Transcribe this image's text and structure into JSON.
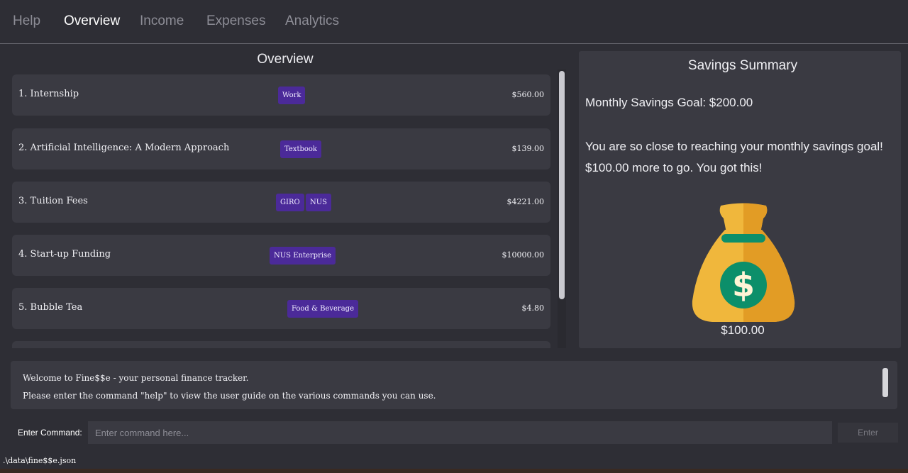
{
  "tabs": [
    {
      "label": "Help",
      "active": false
    },
    {
      "label": "Overview",
      "active": true
    },
    {
      "label": "Income",
      "active": false
    },
    {
      "label": "Expenses",
      "active": false
    },
    {
      "label": "Analytics",
      "active": false
    }
  ],
  "overview": {
    "title": "Overview",
    "items": [
      {
        "name": "1. Internship",
        "tags": [
          "Work"
        ],
        "amount": "$560.00"
      },
      {
        "name": "2. Artificial Intelligence: A Modern Approach",
        "tags": [
          "Textbook"
        ],
        "amount": "$139.00"
      },
      {
        "name": "3. Tuition Fees",
        "tags": [
          "GIRO",
          "NUS"
        ],
        "amount": "$4221.00"
      },
      {
        "name": "4. Start-up Funding",
        "tags": [
          "NUS Enterprise"
        ],
        "amount": "$10000.00"
      },
      {
        "name": "5. Bubble Tea",
        "tags": [
          "Food & Beverage"
        ],
        "amount": "$4.80"
      }
    ]
  },
  "savings": {
    "title": "Savings Summary",
    "goal": "Monthly Savings Goal: $200.00",
    "message_line1": "You are so close to reaching your monthly savings goal!",
    "message_line2": "$100.00 more to go. You got this!",
    "icon": "money-bag-icon",
    "amount": "$100.00"
  },
  "result": {
    "line1": "Welcome to Fine$$e - your personal finance tracker.",
    "line2": "Please enter the command \"help\" to view the user guide on the various commands you can use."
  },
  "command": {
    "label": "Enter Command:",
    "placeholder": "Enter command here...",
    "button": "Enter"
  },
  "status": {
    "path": ".\\data\\fine$$e.json"
  },
  "colors": {
    "background": "#2e2e35",
    "card": "#3a3a42",
    "tag": "#4b2a99",
    "bag_gold": "#f0b73c",
    "bag_green": "#0c8f6a"
  }
}
